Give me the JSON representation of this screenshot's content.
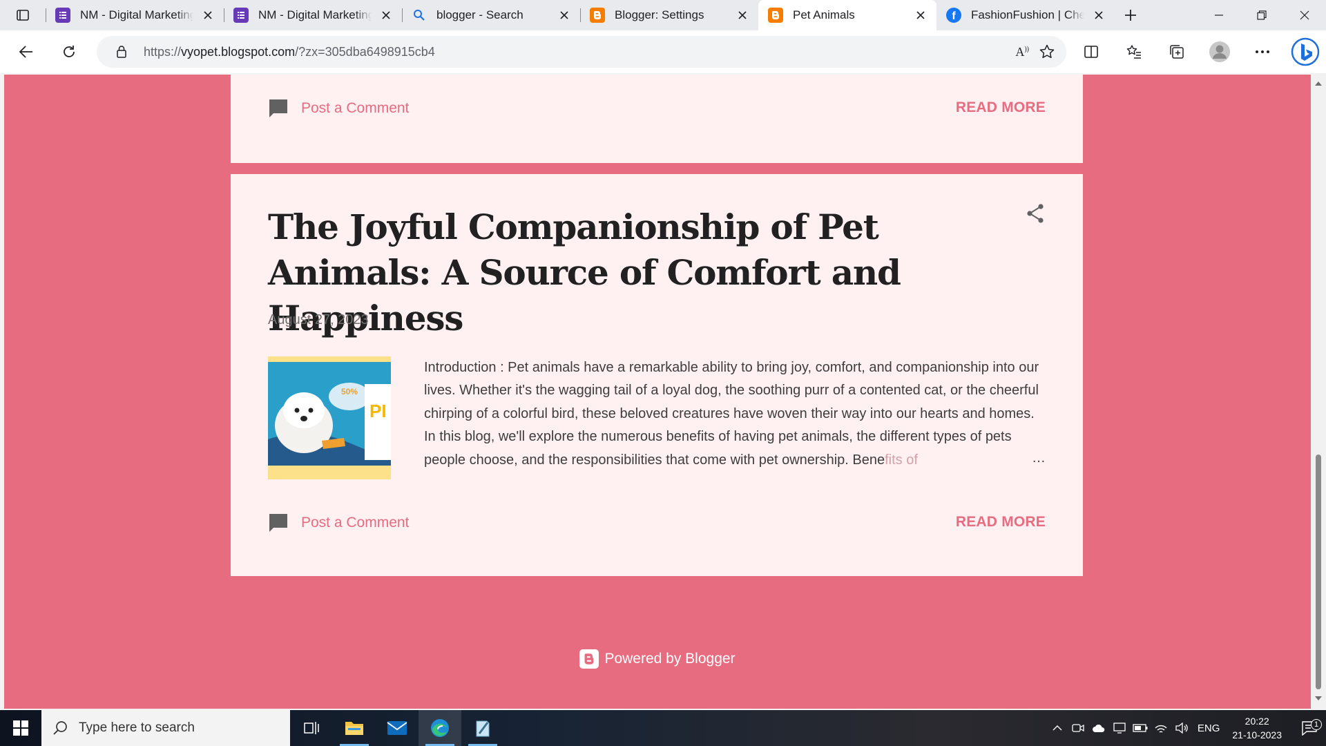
{
  "browser": {
    "tabs": [
      {
        "title": "NM - Digital Marketing",
        "icon": "forms-icon",
        "active": false
      },
      {
        "title": "NM - Digital Marketing",
        "icon": "forms-icon",
        "active": false
      },
      {
        "title": "blogger - Search",
        "icon": "search-icon",
        "active": false
      },
      {
        "title": "Blogger: Settings",
        "icon": "blogger-icon",
        "active": false
      },
      {
        "title": "Pet Animals",
        "icon": "blogger-icon",
        "active": true
      },
      {
        "title": "FashionFushion | Chennai",
        "icon": "facebook-icon",
        "active": false
      }
    ],
    "url_prefix": "https://",
    "url_host": "vyopet.blogspot.com",
    "url_rest": "/?zx=305dba6498915cb4"
  },
  "blog": {
    "prev_post": {
      "comment_label": "Post a Comment",
      "read_more": "READ MORE"
    },
    "post": {
      "title": "The Joyful Companionship of Pet Animals: A Source of Comfort and Happiness",
      "date": "August 27, 2023",
      "snippet": "Introduction : Pet animals have a remarkable ability to bring joy, comfort, and companionship into our lives. Whether it's the wagging tail of a loyal dog, the soothing purr of a contented cat, or the cheerful chirping of a colorful bird, these beloved creatures have woven their way into our hearts and homes. In this blog, we'll explore the numerous benefits of having pet animals, the different types of pets people choose, and the responsibilities that come with pet ownership. Bene",
      "snippet_fade": "fits of",
      "ellipsis": "…",
      "thumb_badge": "50%",
      "thumb_text": "PI",
      "comment_label": "Post a Comment",
      "read_more": "READ MORE"
    },
    "footer": "Powered by Blogger",
    "colors": {
      "accent": "#e76c80",
      "card": "#fff0f1"
    }
  },
  "taskbar": {
    "search_placeholder": "Type here to search",
    "language": "ENG",
    "time": "20:22",
    "date": "21-10-2023",
    "notification_count": "1"
  }
}
